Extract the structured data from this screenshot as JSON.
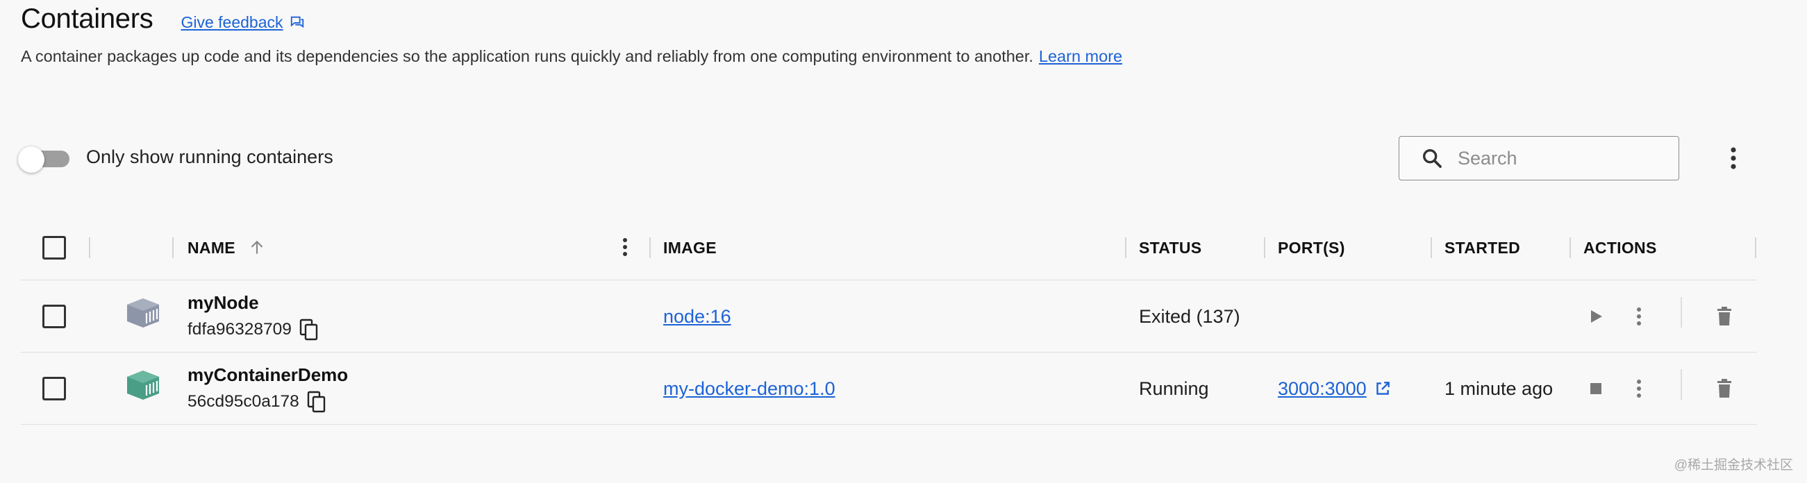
{
  "header": {
    "title": "Containers",
    "feedback_label": "Give feedback"
  },
  "description": {
    "text": "A container packages up code and its dependencies so the application runs quickly and reliably from one computing environment to another.",
    "learn_more": "Learn more"
  },
  "toolbar": {
    "toggle_label": "Only show running containers",
    "toggle_on": false,
    "search_placeholder": "Search"
  },
  "table": {
    "columns": {
      "name": "NAME",
      "image": "IMAGE",
      "status": "STATUS",
      "ports": "PORT(S)",
      "started": "STARTED",
      "actions": "ACTIONS"
    },
    "rows": [
      {
        "name": "myNode",
        "id": "fdfa96328709",
        "image": "node:16",
        "status": "Exited (137)",
        "ports": "",
        "started": "",
        "running": false,
        "icon_color": "#8d96a8"
      },
      {
        "name": "myContainerDemo",
        "id": "56cd95c0a178",
        "image": "my-docker-demo:1.0",
        "status": "Running",
        "ports": "3000:3000",
        "started": "1 minute ago",
        "running": true,
        "icon_color": "#4a9e86"
      }
    ]
  },
  "watermark": "@稀土掘金技术社区",
  "colors": {
    "link": "#1c63d6",
    "background": "#f8f8f8"
  }
}
